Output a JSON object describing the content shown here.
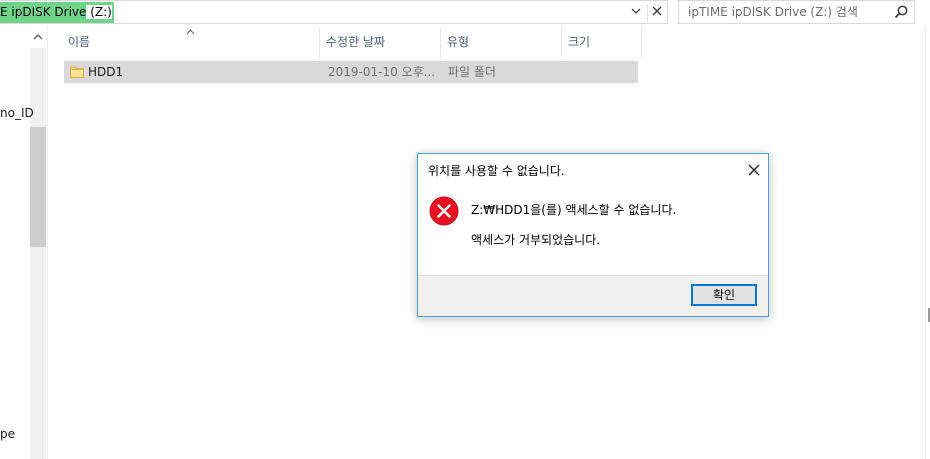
{
  "address_bar": {
    "path_visible": "E ipDISK Drive",
    "path_drive": " (Z:)",
    "dropdown_icon": "chevron-down-icon",
    "clear_icon": "close-icon"
  },
  "search": {
    "placeholder": "ipTIME ipDISK Drive (Z:) 검색",
    "icon": "search-icon"
  },
  "nav_pane": {
    "labels": [
      "no_ID",
      "pe"
    ]
  },
  "columns": {
    "name": "이름",
    "modified": "수정한 날짜",
    "type": "유형",
    "size": "크기"
  },
  "files": [
    {
      "name": "HDD1",
      "modified": "2019-01-10 오후...",
      "type": "파일 폴더",
      "size": ""
    }
  ],
  "dialog": {
    "title": "위치를 사용할 수 없습니다.",
    "message_line1": "Z:₩HDD1을(를) 액세스할 수 없습니다.",
    "message_line2": "액세스가 거부되었습니다.",
    "ok_label": "확인",
    "accent_color": "#0078d7",
    "error_color": "#e81123"
  }
}
